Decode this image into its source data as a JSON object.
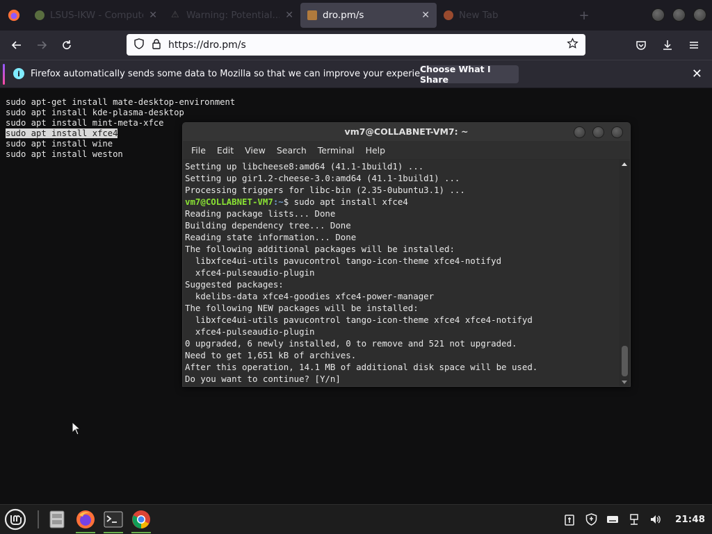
{
  "browser": {
    "tabs": [
      {
        "label": "LSUS-IKW - Computer...",
        "favicon": "linux-mint-icon",
        "color": "#8bb158",
        "active": false
      },
      {
        "label": "Warning: Potential...",
        "favicon": "warning-icon",
        "color": "#777777",
        "active": false
      },
      {
        "label": "dro.pm/s",
        "favicon": "page-icon",
        "color": "#b07a3d",
        "active": true
      },
      {
        "label": "New Tab",
        "favicon": "firefox-icon",
        "color": "#ff7139",
        "active": false
      }
    ],
    "url": "https://dro.pm/s",
    "notification": {
      "text": "Firefox automatically sends some data to Mozilla so that we can improve your experience.",
      "button": "Choose What I Share"
    }
  },
  "page": {
    "lines": [
      "sudo apt-get install mate-desktop-environment",
      "sudo apt install kde-plasma-desktop",
      "sudo apt install mint-meta-xfce",
      "sudo apt install xfce4",
      "sudo apt install wine",
      "sudo apt install weston"
    ],
    "selected_line_index": 3
  },
  "terminal": {
    "title": "vm7@COLLABNET-VM7: ~",
    "menu": [
      "File",
      "Edit",
      "View",
      "Search",
      "Terminal",
      "Help"
    ],
    "prompt_user": "vm7@COLLABNET-VM7",
    "prompt_path": ":~",
    "prompt_cmd": "$ sudo apt install xfce4",
    "lines_before": [
      "Setting up libcheese8:amd64 (41.1-1build1) ...",
      "Setting up gir1.2-cheese-3.0:amd64 (41.1-1build1) ...",
      "Processing triggers for libc-bin (2.35-0ubuntu3.1) ..."
    ],
    "lines_after": [
      "Reading package lists... Done",
      "Building dependency tree... Done",
      "Reading state information... Done",
      "The following additional packages will be installed:",
      "  libxfce4ui-utils pavucontrol tango-icon-theme xfce4-notifyd",
      "  xfce4-pulseaudio-plugin",
      "Suggested packages:",
      "  kdelibs-data xfce4-goodies xfce4-power-manager",
      "The following NEW packages will be installed:",
      "  libxfce4ui-utils pavucontrol tango-icon-theme xfce4 xfce4-notifyd",
      "  xfce4-pulseaudio-plugin",
      "0 upgraded, 6 newly installed, 0 to remove and 521 not upgraded.",
      "Need to get 1,651 kB of archives.",
      "After this operation, 14.1 MB of additional disk space will be used.",
      "Do you want to continue? [Y/n] "
    ]
  },
  "taskbar": {
    "apps": [
      "file-manager-icon",
      "firefox-icon",
      "terminal-icon",
      "chrome-icon"
    ],
    "clock": "21:48",
    "tray": [
      "clipboard-icon",
      "shield-update-icon",
      "keyboard-icon",
      "network-icon",
      "volume-icon"
    ]
  },
  "colors": {
    "prompt_green": "#8ae234",
    "prompt_blue": "#729fcf",
    "firefox_chrome": "#2b2a33"
  }
}
